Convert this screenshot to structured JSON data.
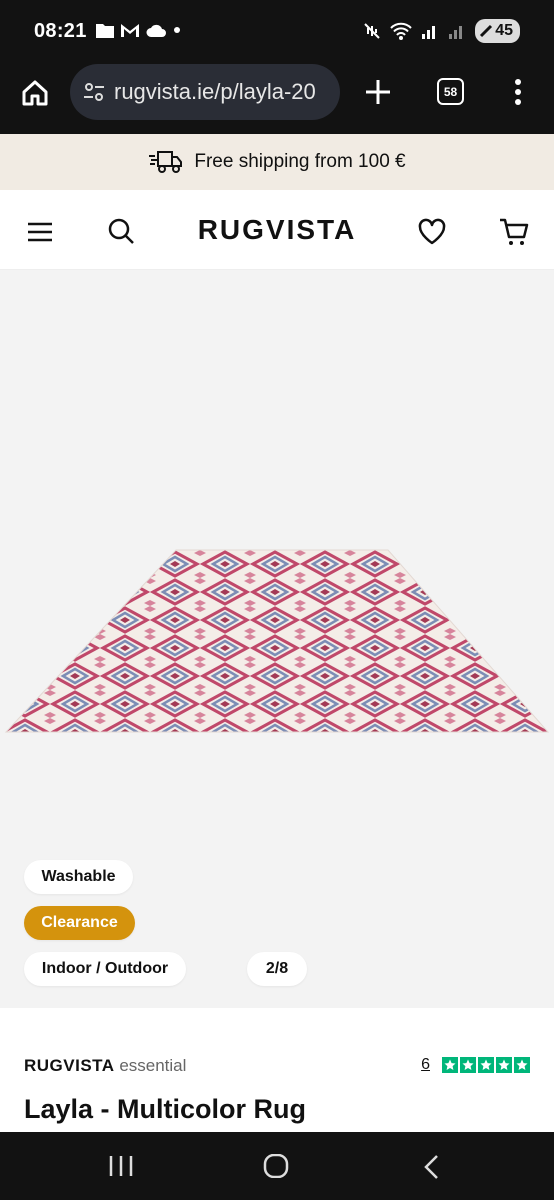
{
  "status_bar": {
    "time": "08:21",
    "battery": "45"
  },
  "browser": {
    "url": "rugvista.ie/p/layla-20",
    "tab_count": "58"
  },
  "banner": {
    "shipping_text": "Free shipping from 100 €"
  },
  "header": {
    "brand": "RUGVISTA"
  },
  "gallery": {
    "badges": [
      "Washable",
      "Clearance",
      "Indoor / Outdoor"
    ],
    "counter": "2/8"
  },
  "product": {
    "brand": "RUGVISTA",
    "line": "essential",
    "review_count": "6",
    "title": "Layla - Multicolor Rug"
  },
  "colors": {
    "clearance": "#d4930d",
    "trustpilot": "#00b67a",
    "banner_bg": "#f1ebe3"
  }
}
